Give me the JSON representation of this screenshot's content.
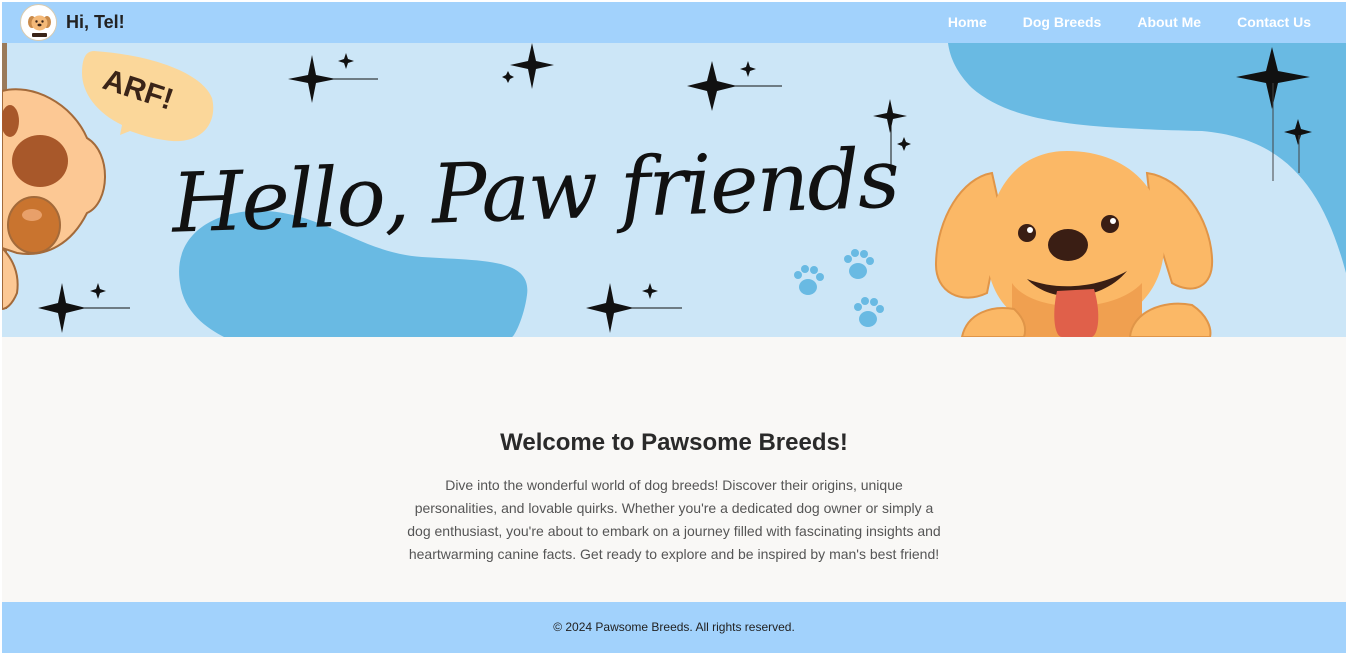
{
  "navbar": {
    "greeting": "Hi, Tel!",
    "logo_icon": "dog-face-logo",
    "links": [
      {
        "label": "Home"
      },
      {
        "label": "Dog Breeds"
      },
      {
        "label": "About Me"
      },
      {
        "label": "Contact Us"
      }
    ]
  },
  "banner": {
    "heading": "Hello, Paw friends",
    "speech_bubble": "ARF!",
    "background_color": "#cce6f7",
    "blob_color": "#69bae3"
  },
  "main": {
    "title": "Welcome to Pawsome Breeds!",
    "description": "Dive into the wonderful world of dog breeds! Discover their origins, unique personalities, and lovable quirks. Whether you're a dedicated dog owner or simply a dog enthusiast, you're about to embark on a journey filled with fascinating insights and heartwarming canine facts. Get ready to explore and be inspired by man's best friend!"
  },
  "footer": {
    "copyright": "© 2024 Pawsome Breeds. All rights reserved."
  },
  "colors": {
    "navbar": "#a2d2fc",
    "nav_text": "#ffffff",
    "page_background": "#f9f8f6"
  }
}
